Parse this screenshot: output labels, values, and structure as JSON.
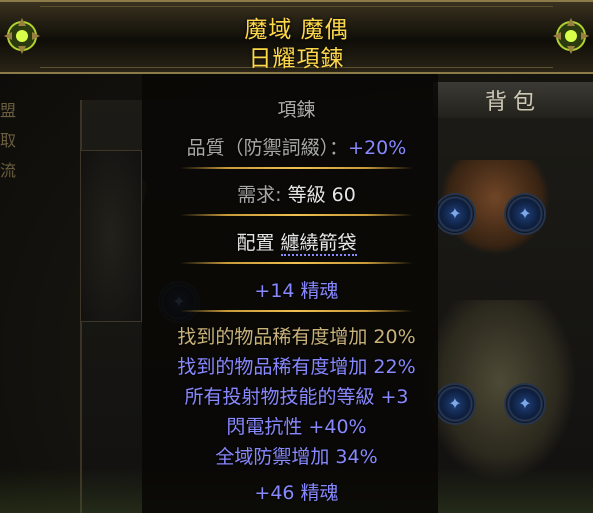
{
  "background": {
    "tab_label": "背包",
    "side_items": [
      "盟",
      "取",
      "流"
    ],
    "panel_label": "背包"
  },
  "item": {
    "name_line1": "魔域 魔偶",
    "name_line2": "日耀項鍊",
    "item_class": "項鍊",
    "quality_label": "品質（防禦詞綴）：",
    "quality_value": "+20%",
    "requirements_label": "需求: ",
    "requirements_value": "等級 60",
    "allocate_label": "配置 ",
    "allocate_value": "纏繞箭袋",
    "implicit": "+14 精魂",
    "mods_crafted": [
      "找到的物品稀有度增加 20%"
    ],
    "mods_explicit": [
      "找到的物品稀有度增加 22%",
      "所有投射物技能的等級 +3",
      "閃電抗性 +40%",
      "全域防禦增加 34%",
      "+46 精魂"
    ]
  },
  "colors": {
    "unique_name": "#ffd84a",
    "magic_mod": "#8888ff",
    "crafted_mod": "#c8b27a",
    "separator": "#f0c050"
  }
}
